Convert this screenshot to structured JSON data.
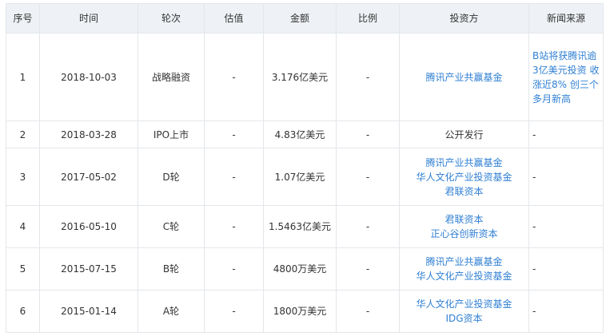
{
  "headers": [
    "序号",
    "时间",
    "轮次",
    "估值",
    "金额",
    "比例",
    "投资方",
    "新闻来源"
  ],
  "rows": [
    {
      "no": "1",
      "date": "2018-10-03",
      "round": "战略融资",
      "valuation": "-",
      "amount": "3.176亿美元",
      "ratio": "-",
      "investors": [
        {
          "name": "腾讯产业共赢基金",
          "link": true
        }
      ],
      "news": "B站将获腾讯逾3亿美元投资 收涨近8% 创三个多月新高",
      "news_link": true
    },
    {
      "no": "2",
      "date": "2018-03-28",
      "round": "IPO上市",
      "valuation": "-",
      "amount": "4.83亿美元",
      "ratio": "-",
      "investors": [
        {
          "name": "公开发行",
          "link": false
        }
      ],
      "news": "-",
      "news_link": false
    },
    {
      "no": "3",
      "date": "2017-05-02",
      "round": "D轮",
      "valuation": "-",
      "amount": "1.07亿美元",
      "ratio": "-",
      "investors": [
        {
          "name": "腾讯产业共赢基金",
          "link": true
        },
        {
          "name": "华人文化产业投资基金",
          "link": true
        },
        {
          "name": "君联资本",
          "link": true
        }
      ],
      "news": "-",
      "news_link": false
    },
    {
      "no": "4",
      "date": "2016-05-10",
      "round": "C轮",
      "valuation": "-",
      "amount": "1.5463亿美元",
      "ratio": "-",
      "investors": [
        {
          "name": "君联资本",
          "link": true
        },
        {
          "name": "正心谷创新资本",
          "link": true
        }
      ],
      "news": "-",
      "news_link": false
    },
    {
      "no": "5",
      "date": "2015-07-15",
      "round": "B轮",
      "valuation": "-",
      "amount": "4800万美元",
      "ratio": "-",
      "investors": [
        {
          "name": "腾讯产业共赢基金",
          "link": true
        },
        {
          "name": "华人文化产业投资基金",
          "link": true
        }
      ],
      "news": "-",
      "news_link": false
    },
    {
      "no": "6",
      "date": "2015-01-14",
      "round": "A轮",
      "valuation": "-",
      "amount": "1800万美元",
      "ratio": "-",
      "investors": [
        {
          "name": "华人文化产业投资基金",
          "link": true
        },
        {
          "name": "IDG资本",
          "link": true
        }
      ],
      "news": "-",
      "news_link": false
    }
  ]
}
